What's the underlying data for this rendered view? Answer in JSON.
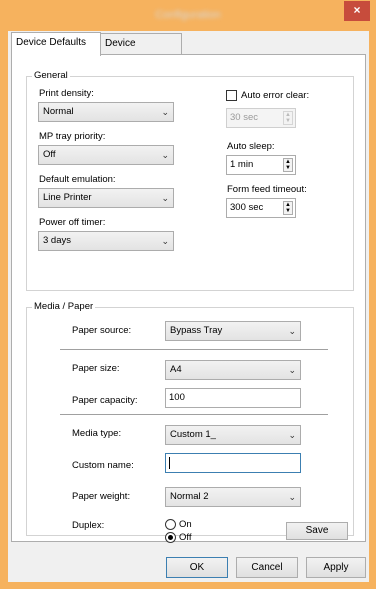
{
  "window": {
    "title": "Configuration",
    "close_glyph": "×"
  },
  "tabs": [
    {
      "label": "Device Defaults",
      "active": true
    },
    {
      "label": "Device Overview",
      "active": false
    }
  ],
  "general": {
    "group_label": "General",
    "print_density": {
      "label": "Print density:",
      "value": "Normal"
    },
    "mp_tray_priority": {
      "label": "MP tray priority:",
      "value": "Off"
    },
    "default_emulation": {
      "label": "Default emulation:",
      "value": "Line Printer"
    },
    "power_off_timer": {
      "label": "Power off timer:",
      "value": "3 days"
    },
    "auto_error_clear": {
      "label": "Auto error clear:",
      "checked": false,
      "value": "30 sec",
      "enabled": false
    },
    "auto_sleep": {
      "label": "Auto sleep:",
      "value": "1 min"
    },
    "form_feed_timeout": {
      "label": "Form feed timeout:",
      "value": "300 sec"
    }
  },
  "media": {
    "group_label": "Media / Paper",
    "paper_source": {
      "label": "Paper source:",
      "value": "Bypass Tray"
    },
    "paper_size": {
      "label": "Paper size:",
      "value": "A4"
    },
    "paper_capacity": {
      "label": "Paper capacity:",
      "value": "100"
    },
    "media_type": {
      "label": "Media type:",
      "value": "Custom 1_"
    },
    "custom_name": {
      "label": "Custom name:",
      "value": ""
    },
    "paper_weight": {
      "label": "Paper weight:",
      "value": "Normal 2"
    },
    "duplex": {
      "label": "Duplex:",
      "options": [
        "On",
        "Off"
      ],
      "selected": "Off"
    },
    "save_label": "Save"
  },
  "footer": {
    "ok_label": "OK",
    "cancel_label": "Cancel",
    "apply_label": "Apply"
  },
  "icons": {
    "chevron": "chevron-down-icon",
    "spin": "spinner-arrows-icon"
  },
  "colors": {
    "title_bar": "#f6b25e",
    "close_button": "#c74c3c",
    "focus_border": "#3c7fb1"
  }
}
